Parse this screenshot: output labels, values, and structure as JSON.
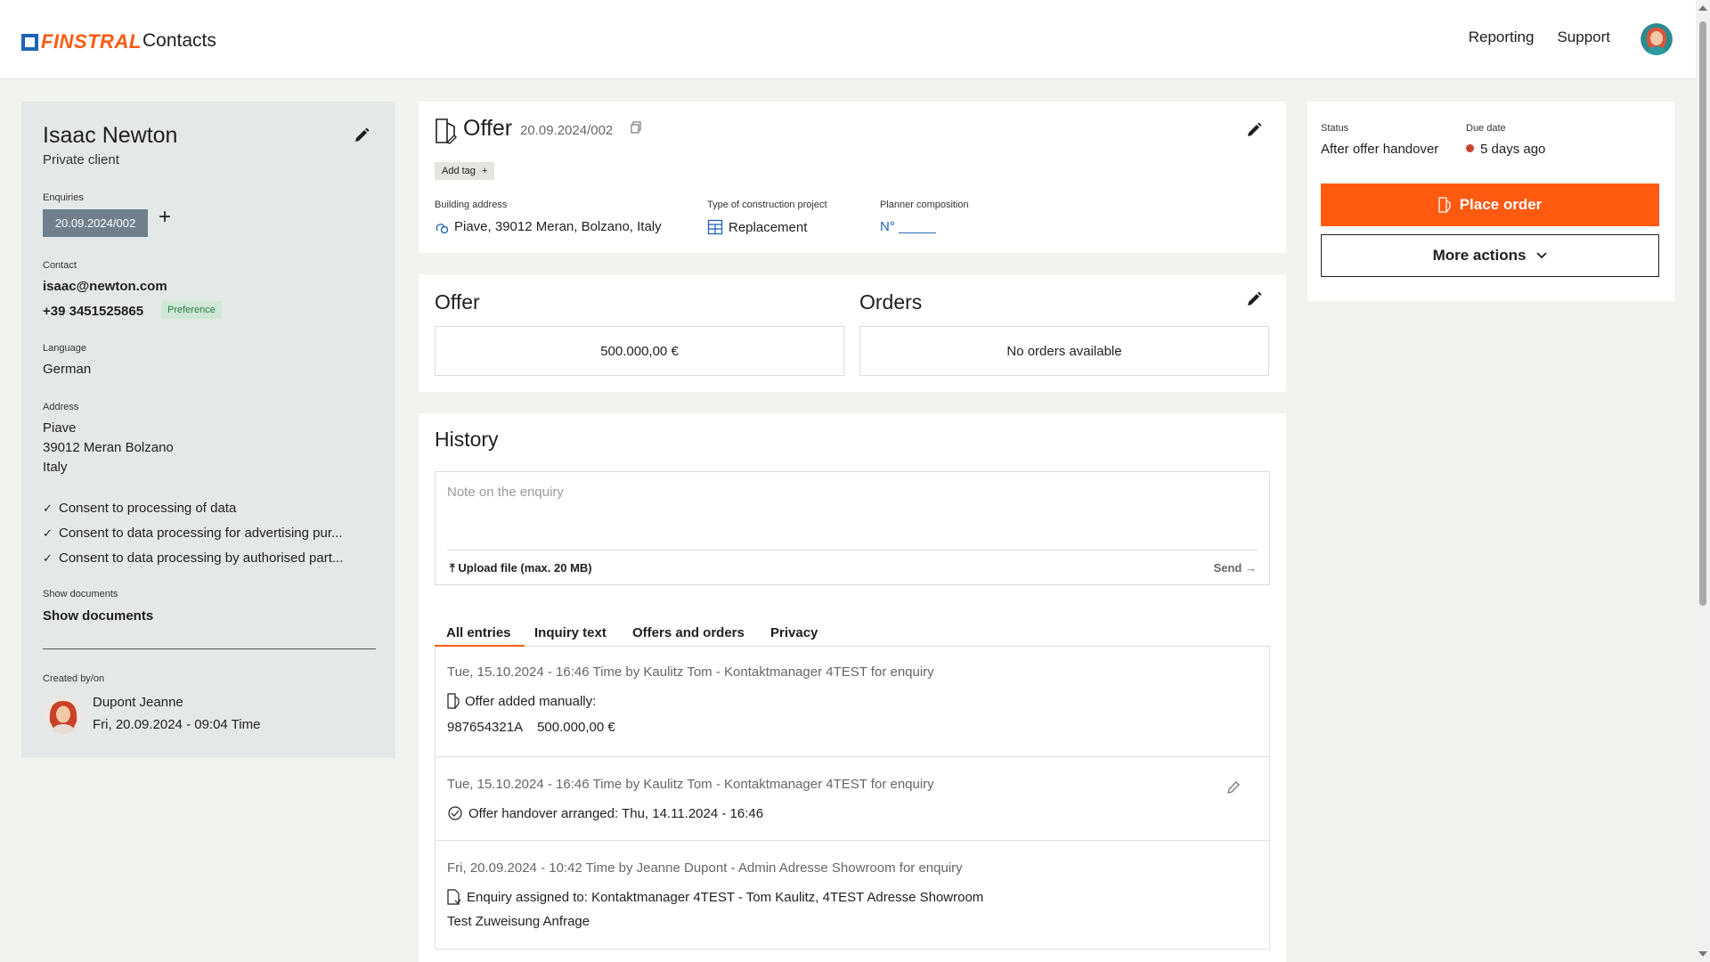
{
  "header": {
    "logo_text": "FINSTRAL",
    "app_name": "Contacts",
    "nav": [
      "Reporting",
      "Support"
    ]
  },
  "contact": {
    "name": "Isaac Newton",
    "type": "Private client",
    "enquiries_label": "Enquiries",
    "enquiry_chip": "20.09.2024/002",
    "add_symbol": "+",
    "contact_label": "Contact",
    "email": "isaac@newton.com",
    "phone": "+39 3451525865",
    "preference_badge": "Preference",
    "language_label": "Language",
    "language": "German",
    "address_label": "Address",
    "address_lines": [
      "Piave",
      "39012 Meran Bolzano",
      "Italy"
    ],
    "consents": [
      "Consent to processing of data",
      "Consent to data processing for advertising pur...",
      "Consent to data processing by authorised part..."
    ],
    "documents_label": "Show documents",
    "documents_link": "Show documents",
    "created_label": "Created by/on",
    "created_by": "Dupont Jeanne",
    "created_on": "Fri, 20.09.2024 - 09:04 Time"
  },
  "offer_header": {
    "title": "Offer",
    "ref": "20.09.2024/002",
    "add_tag": "Add tag",
    "add_tag_symbol": "+",
    "building_address_label": "Building address",
    "building_address": "Piave, 39012 Meran, Bolzano, Italy",
    "construction_type_label": "Type of construction project",
    "construction_type": "Replacement",
    "planner_label": "Planner composition",
    "planner_value": "N° _____"
  },
  "summary": {
    "offer_title": "Offer",
    "offer_value": "500.000,00 €",
    "orders_title": "Orders",
    "orders_value": "No orders available"
  },
  "history": {
    "title": "History",
    "note_placeholder": "Note on the enquiry",
    "upload": "Upload file (max. 20 MB)",
    "send": "Send",
    "tabs": [
      "All entries",
      "Inquiry text",
      "Offers and orders",
      "Privacy"
    ],
    "entries": [
      {
        "meta": "Tue, 15.10.2024 - 16:46 Time by Kaulitz Tom - Kontaktmanager 4TEST for enquiry",
        "line1": "Offer added manually:",
        "line2_id": "987654321A",
        "line2_value": "500.000,00 €"
      },
      {
        "meta": "Tue, 15.10.2024 - 16:46 Time by Kaulitz Tom - Kontaktmanager 4TEST for enquiry",
        "line1": "Offer handover arranged: Thu, 14.11.2024 - 16:46"
      },
      {
        "meta": "Fri, 20.09.2024 - 10:42 Time by Jeanne Dupont - Admin Adresse Showroom for enquiry",
        "line1": "Enquiry assigned to: Kontaktmanager 4TEST - Tom Kaulitz, 4TEST Adresse Showroom",
        "line2": "Test Zuweisung Anfrage"
      }
    ]
  },
  "status": {
    "status_label": "Status",
    "status_value": "After offer handover",
    "due_label": "Due date",
    "due_value": "5 days ago",
    "place_order": "Place order",
    "more_actions": "More actions"
  },
  "colors": {
    "accent": "#ff5a10",
    "brand_blue": "#1e63b8",
    "panel": "#e4e8e9",
    "overdue": "#c8432f"
  }
}
